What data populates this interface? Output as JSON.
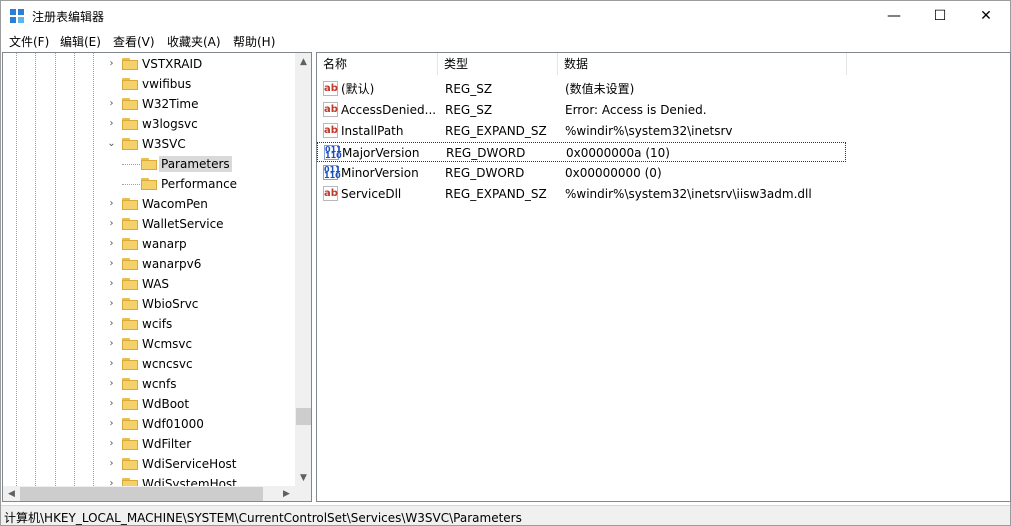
{
  "window": {
    "title": "注册表编辑器",
    "controls": {
      "minimize": "—",
      "maximize": "☐",
      "close": "✕"
    }
  },
  "menu": [
    "文件(F)",
    "编辑(E)",
    "查看(V)",
    "收藏夹(A)",
    "帮助(H)"
  ],
  "tree": {
    "items": [
      {
        "label": "VSTXRAID",
        "level": 1,
        "expander": "›"
      },
      {
        "label": "vwifibus",
        "level": 1,
        "expander": ""
      },
      {
        "label": "W32Time",
        "level": 1,
        "expander": "›"
      },
      {
        "label": "w3logsvc",
        "level": 1,
        "expander": "›"
      },
      {
        "label": "W3SVC",
        "level": 1,
        "expander": "⌄"
      },
      {
        "label": "Parameters",
        "level": 2,
        "expander": "",
        "selected": true
      },
      {
        "label": "Performance",
        "level": 2,
        "expander": ""
      },
      {
        "label": "WacomPen",
        "level": 1,
        "expander": "›"
      },
      {
        "label": "WalletService",
        "level": 1,
        "expander": "›"
      },
      {
        "label": "wanarp",
        "level": 1,
        "expander": "›"
      },
      {
        "label": "wanarpv6",
        "level": 1,
        "expander": "›"
      },
      {
        "label": "WAS",
        "level": 1,
        "expander": "›"
      },
      {
        "label": "WbioSrvc",
        "level": 1,
        "expander": "›"
      },
      {
        "label": "wcifs",
        "level": 1,
        "expander": "›"
      },
      {
        "label": "Wcmsvc",
        "level": 1,
        "expander": "›"
      },
      {
        "label": "wcncsvc",
        "level": 1,
        "expander": "›"
      },
      {
        "label": "wcnfs",
        "level": 1,
        "expander": "›"
      },
      {
        "label": "WdBoot",
        "level": 1,
        "expander": "›"
      },
      {
        "label": "Wdf01000",
        "level": 1,
        "expander": "›"
      },
      {
        "label": "WdFilter",
        "level": 1,
        "expander": "›"
      },
      {
        "label": "WdiServiceHost",
        "level": 1,
        "expander": "›"
      },
      {
        "label": "WdiSystemHost",
        "level": 1,
        "expander": "›"
      }
    ],
    "scroll": {
      "up": "▲",
      "down": "▼",
      "left": "◀",
      "right": "▶"
    }
  },
  "list": {
    "columns": [
      "名称",
      "类型",
      "数据"
    ],
    "rows": [
      {
        "icon": "ab",
        "name": "(默认)",
        "type": "REG_SZ",
        "data": "(数值未设置)"
      },
      {
        "icon": "ab",
        "name": "AccessDenied...",
        "type": "REG_SZ",
        "data": "Error: Access is Denied."
      },
      {
        "icon": "ab",
        "name": "InstallPath",
        "type": "REG_EXPAND_SZ",
        "data": "%windir%\\system32\\inetsrv"
      },
      {
        "icon": "bin",
        "name": "MajorVersion",
        "type": "REG_DWORD",
        "data": "0x0000000a (10)",
        "focused": true
      },
      {
        "icon": "bin",
        "name": "MinorVersion",
        "type": "REG_DWORD",
        "data": "0x00000000 (0)"
      },
      {
        "icon": "ab",
        "name": "ServiceDll",
        "type": "REG_EXPAND_SZ",
        "data": "%windir%\\system32\\inetsrv\\iisw3adm.dll"
      }
    ],
    "icon_labels": {
      "ab": "ab",
      "bin": "011\n110"
    }
  },
  "status": {
    "path": "计算机\\HKEY_LOCAL_MACHINE\\SYSTEM\\CurrentControlSet\\Services\\W3SVC\\Parameters"
  }
}
